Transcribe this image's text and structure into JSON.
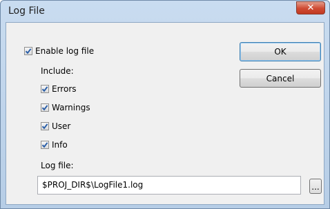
{
  "window": {
    "title": "Log File",
    "close_glyph": "✕"
  },
  "enable": {
    "label": "Enable log file",
    "checked": true
  },
  "include": {
    "label": "Include:",
    "items": [
      {
        "label": "Errors",
        "checked": true
      },
      {
        "label": "Warnings",
        "checked": true
      },
      {
        "label": "User",
        "checked": true
      },
      {
        "label": "Info",
        "checked": true
      }
    ]
  },
  "logfile": {
    "label": "Log file:",
    "value": "$PROJ_DIR$\\LogFile1.log",
    "browse_label": "..."
  },
  "buttons": {
    "ok": "OK",
    "cancel": "Cancel"
  },
  "colors": {
    "checkmark": "#2b5fa8",
    "close_button": "#c9452f"
  }
}
